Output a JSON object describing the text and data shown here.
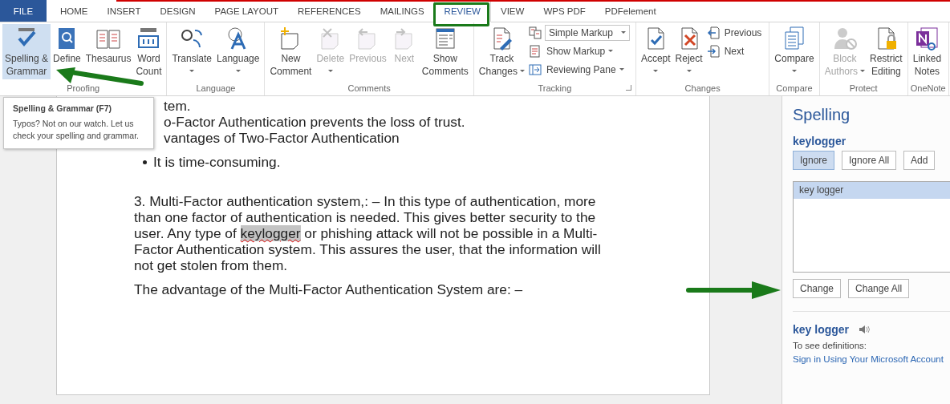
{
  "tabs": [
    {
      "label": "FILE",
      "kind": "file",
      "selected": false
    },
    {
      "label": "HOME",
      "kind": "tab",
      "selected": false
    },
    {
      "label": "INSERT",
      "kind": "tab",
      "selected": false
    },
    {
      "label": "DESIGN",
      "kind": "tab",
      "selected": false
    },
    {
      "label": "PAGE LAYOUT",
      "kind": "tab",
      "selected": false
    },
    {
      "label": "REFERENCES",
      "kind": "tab",
      "selected": false
    },
    {
      "label": "MAILINGS",
      "kind": "tab",
      "selected": false
    },
    {
      "label": "REVIEW",
      "kind": "tab",
      "selected": true
    },
    {
      "label": "VIEW",
      "kind": "tab",
      "selected": false
    },
    {
      "label": "WPS PDF",
      "kind": "tab",
      "selected": false
    },
    {
      "label": "PDFelement",
      "kind": "tab",
      "selected": false
    }
  ],
  "ribbon": {
    "groups": [
      {
        "label": "Proofing",
        "launcher": false,
        "items": [
          {
            "kind": "large",
            "label": "Spelling &\nGrammar",
            "dropdown": false,
            "disabled": false,
            "selected": true
          },
          {
            "kind": "large",
            "label": "Define",
            "dropdown": false,
            "disabled": false,
            "selected": false
          },
          {
            "kind": "large",
            "label": "Thesaurus",
            "dropdown": false,
            "disabled": false,
            "selected": false
          },
          {
            "kind": "large",
            "label": "Word\nCount",
            "dropdown": false,
            "disabled": false,
            "selected": false
          }
        ]
      },
      {
        "label": "Language",
        "launcher": false,
        "items": [
          {
            "kind": "large",
            "label": "Translate",
            "dropdown": true,
            "disabled": false,
            "selected": false
          },
          {
            "kind": "large",
            "label": "Language",
            "dropdown": true,
            "disabled": false,
            "selected": false
          }
        ]
      },
      {
        "label": "Comments",
        "launcher": false,
        "items": [
          {
            "kind": "large",
            "label": "New\nComment",
            "dropdown": false,
            "disabled": false,
            "selected": false
          },
          {
            "kind": "large",
            "label": "Delete",
            "dropdown": true,
            "disabled": true,
            "selected": false
          },
          {
            "kind": "large",
            "label": "Previous",
            "dropdown": false,
            "disabled": true,
            "selected": false
          },
          {
            "kind": "large",
            "label": "Next",
            "dropdown": false,
            "disabled": true,
            "selected": false
          },
          {
            "kind": "large",
            "label": "Show\nComments",
            "dropdown": false,
            "disabled": false,
            "selected": false
          }
        ]
      },
      {
        "label": "Tracking",
        "launcher": true,
        "items": [
          {
            "kind": "large",
            "label": "Track\nChanges",
            "dropdown": true,
            "disabled": false,
            "selected": false
          },
          {
            "kind": "stack",
            "items": [
              {
                "kind": "field",
                "label": "Simple Markup",
                "dropdown": true
              },
              {
                "kind": "small",
                "label": "Show Markup",
                "dropdown": true
              },
              {
                "kind": "small",
                "label": "Reviewing Pane",
                "dropdown": true
              }
            ]
          }
        ]
      },
      {
        "label": "Changes",
        "launcher": false,
        "items": [
          {
            "kind": "large",
            "label": "Accept",
            "dropdown": true,
            "disabled": false,
            "selected": false
          },
          {
            "kind": "large",
            "label": "Reject",
            "dropdown": true,
            "disabled": false,
            "selected": false
          },
          {
            "kind": "stack",
            "items": [
              {
                "kind": "small",
                "label": "Previous",
                "dropdown": false
              },
              {
                "kind": "small",
                "label": "Next",
                "dropdown": false
              }
            ]
          }
        ]
      },
      {
        "label": "Compare",
        "launcher": false,
        "items": [
          {
            "kind": "large",
            "label": "Compare",
            "dropdown": true,
            "disabled": false,
            "selected": false
          }
        ]
      },
      {
        "label": "Protect",
        "launcher": false,
        "items": [
          {
            "kind": "large",
            "label": "Block\nAuthors",
            "dropdown": true,
            "disabled": true,
            "selected": false
          },
          {
            "kind": "large",
            "label": "Restrict\nEditing",
            "dropdown": false,
            "disabled": false,
            "selected": false
          }
        ]
      },
      {
        "label": "OneNote",
        "launcher": false,
        "items": [
          {
            "kind": "large",
            "label": "Linked\nNotes",
            "dropdown": false,
            "disabled": false,
            "selected": false
          }
        ]
      }
    ]
  },
  "tooltip": {
    "title": "Spelling & Grammar (F7)",
    "text": "Typos? Not on our watch. Let us check your spelling and grammar."
  },
  "document": {
    "blocks": [
      {
        "kind": "cut",
        "text": "tem."
      },
      {
        "kind": "cut",
        "text": "o-Factor Authentication prevents the loss of trust."
      },
      {
        "kind": "cut",
        "text": "vantages of Two-Factor Authentication"
      },
      {
        "kind": "bullet",
        "text": "It is time-consuming."
      },
      {
        "kind": "flagged",
        "before": "3. Multi-Factor authentication system,: – In this type of authentication, more than one factor of authentication is needed. This gives better security to the user. Any type of ",
        "word": "keylogger",
        "after": " or phishing attack will not be possible in a Multi-Factor Authentication system. This assures the user, that the information will not get stolen from them."
      },
      {
        "kind": "text",
        "text": "The advantage of the Multi-Factor Authentication System are: –"
      }
    ]
  },
  "pane": {
    "title": "Spelling",
    "word": "keylogger",
    "top_buttons": [
      {
        "label": "Ignore",
        "selected": true
      },
      {
        "label": "Ignore All",
        "selected": false
      },
      {
        "label": "Add",
        "selected": false
      }
    ],
    "suggestions": [
      {
        "label": "key logger",
        "selected": true
      }
    ],
    "bottom_buttons": [
      "Change",
      "Change All"
    ],
    "definition": {
      "word": "key logger",
      "note": "To see definitions:",
      "link": "Sign in Using Your Microsoft Account"
    }
  }
}
